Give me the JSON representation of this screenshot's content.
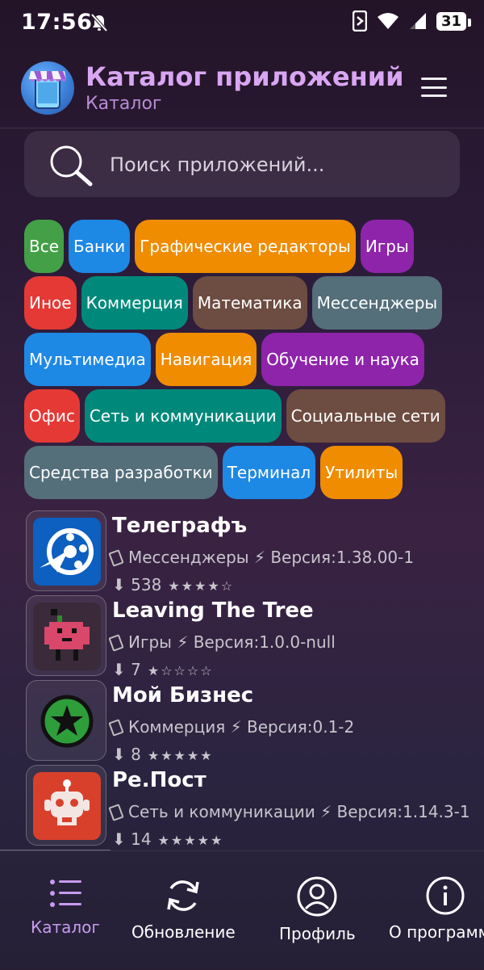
{
  "status": {
    "time": "17:56",
    "battery": "31"
  },
  "header": {
    "title": "Каталог приложений",
    "subtitle": "Каталог",
    "logo_icon": "storefront-phone-icon",
    "menu_icon": "hamburger-menu-icon"
  },
  "search": {
    "placeholder": "Поиск приложений...",
    "value": ""
  },
  "categories": [
    {
      "label": "Все",
      "color": "#43a047"
    },
    {
      "label": "Банки",
      "color": "#1e88e5"
    },
    {
      "label": "Графические редакторы",
      "color": "#f08c00"
    },
    {
      "label": "Игры",
      "color": "#8e24aa"
    },
    {
      "label": "Иное",
      "color": "#e53935"
    },
    {
      "label": "Коммерция",
      "color": "#00897b"
    },
    {
      "label": "Математика",
      "color": "#6d4c41"
    },
    {
      "label": "Мессенджеры",
      "color": "#546e7a"
    },
    {
      "label": "Мультимедиа",
      "color": "#1e88e5"
    },
    {
      "label": "Навигация",
      "color": "#f08c00"
    },
    {
      "label": "Обучение и наука",
      "color": "#8e24aa"
    },
    {
      "label": "Офис",
      "color": "#e53935"
    },
    {
      "label": "Сеть и коммуникации",
      "color": "#00897b"
    },
    {
      "label": "Социальные сети",
      "color": "#6d4c41"
    },
    {
      "label": "Средства разработки",
      "color": "#546e7a"
    },
    {
      "label": "Терминал",
      "color": "#1e88e5"
    },
    {
      "label": "Утилиты",
      "color": "#f08c00"
    }
  ],
  "apps": [
    {
      "name": "Телеграфъ",
      "meta": "Мессенджеры ⚡ Версия:1.38.00-1",
      "downloads": "538",
      "stars": "★★★★☆",
      "icon": "telegraph-icon"
    },
    {
      "name": "Leaving The Tree",
      "meta": "Игры ⚡ Версия:1.0.0-null",
      "downloads": "7",
      "stars": "★☆☆☆☆",
      "icon": "pixel-apple-character-icon"
    },
    {
      "name": "Мой Бизнес",
      "meta": "Коммерция ⚡ Версия:0.1-2",
      "downloads": "8",
      "stars": "★★★★★",
      "icon": "green-star-icon"
    },
    {
      "name": "Ре.Пост",
      "meta": "Сеть и коммуникации ⚡ Версия:1.14.3-1",
      "downloads": "14",
      "stars": "★★★★★",
      "icon": "robot-face-icon"
    }
  ],
  "nav": [
    {
      "label": "Каталог",
      "icon": "list-icon",
      "active": true
    },
    {
      "label": "Обновление",
      "icon": "refresh-icon",
      "active": false
    },
    {
      "label": "Профиль",
      "icon": "profile-icon",
      "active": false
    },
    {
      "label": "О программе",
      "icon": "info-icon",
      "active": false
    }
  ],
  "colors": {
    "accent": "#d9a6f2",
    "nav_active": "#c89af0"
  }
}
